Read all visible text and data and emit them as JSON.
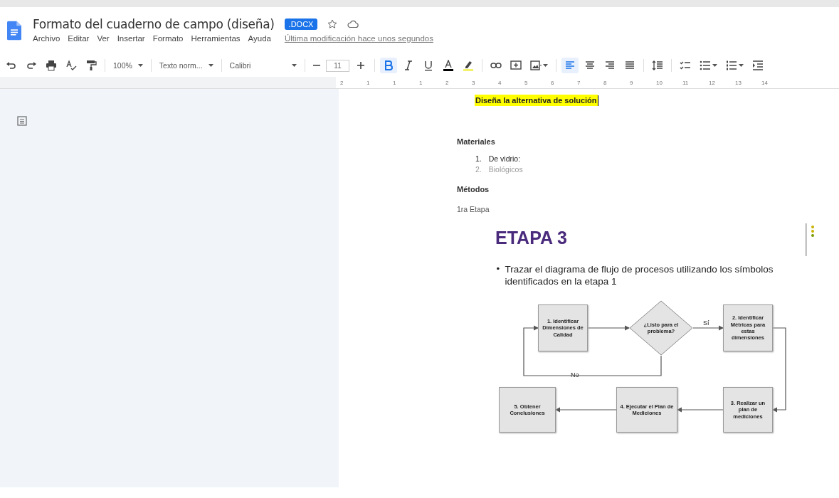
{
  "document": {
    "title": "Formato del cuaderno de campo (diseña)",
    "badge": ".DOCX"
  },
  "menu": [
    "Archivo",
    "Editar",
    "Ver",
    "Insertar",
    "Formato",
    "Herramientas",
    "Ayuda"
  ],
  "last_edit": "Última modificación hace unos segundos",
  "toolbar": {
    "dropdowns": [
      "100%",
      "Texto norm...",
      "Calibri"
    ],
    "font_size": "11",
    "format_toggles": [
      {
        "selected": true
      },
      {
        "selected": false
      },
      {
        "selected": false
      }
    ],
    "align_toggles": [
      {
        "selected": true
      },
      {
        "selected": false
      },
      {
        "selected": false
      },
      {
        "selected": false
      }
    ]
  },
  "ruler": [
    "2",
    "1",
    "1",
    "1",
    "2",
    "3",
    "4",
    "5",
    "6",
    "7",
    "8",
    "9",
    "10",
    "11",
    "12",
    "13",
    "14"
  ],
  "body": {
    "highlighted_heading": "Diseña la alternativa de solución",
    "materials_heading": "Materiales",
    "materials": [
      {
        "number": "1.",
        "text": "De vidrio:",
        "dimmed": false
      },
      {
        "number": "2.",
        "text": "Biológicos",
        "dimmed": true
      }
    ],
    "methods_heading": "Métodos",
    "stage_label": "1ra Etapa",
    "figure": {
      "heading": "ETAPA 3",
      "bullet": "Trazar el diagrama de flujo de procesos utilizando los símbolos identificados en la etapa 1",
      "nodes": [
        {
          "kind": "process",
          "text": "1. Identificar Dimensiones de Calidad"
        },
        {
          "kind": "decision",
          "text": "¿Listo para el problema?",
          "yes_label": "Sí",
          "no_label": "No"
        },
        {
          "kind": "process",
          "text": "2. Identificar Métricas para estas dimensiones"
        },
        {
          "kind": "process",
          "text": "5. Obtener Conclusiones"
        },
        {
          "kind": "process",
          "text": "4. Ejecutar el Plan de Mediciones"
        },
        {
          "kind": "process",
          "text": "3. Realizar un plan de mediciones"
        }
      ]
    }
  }
}
